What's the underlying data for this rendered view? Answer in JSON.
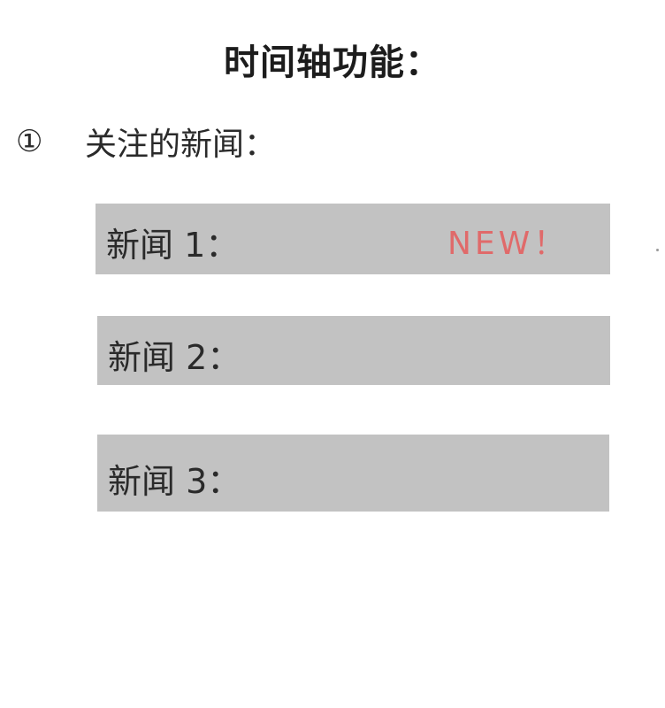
{
  "page": {
    "title": "时间轴功能："
  },
  "section": {
    "number": "①",
    "heading": "关注的新闻："
  },
  "news_items": [
    {
      "label": "新闻 1：",
      "badge": "NEW！"
    },
    {
      "label": "新闻 2："
    },
    {
      "label": "新闻 3："
    }
  ],
  "colors": {
    "item_background": "#c2c2c2",
    "badge_color": "#e06a6a",
    "text_color": "#2a2a2a"
  }
}
